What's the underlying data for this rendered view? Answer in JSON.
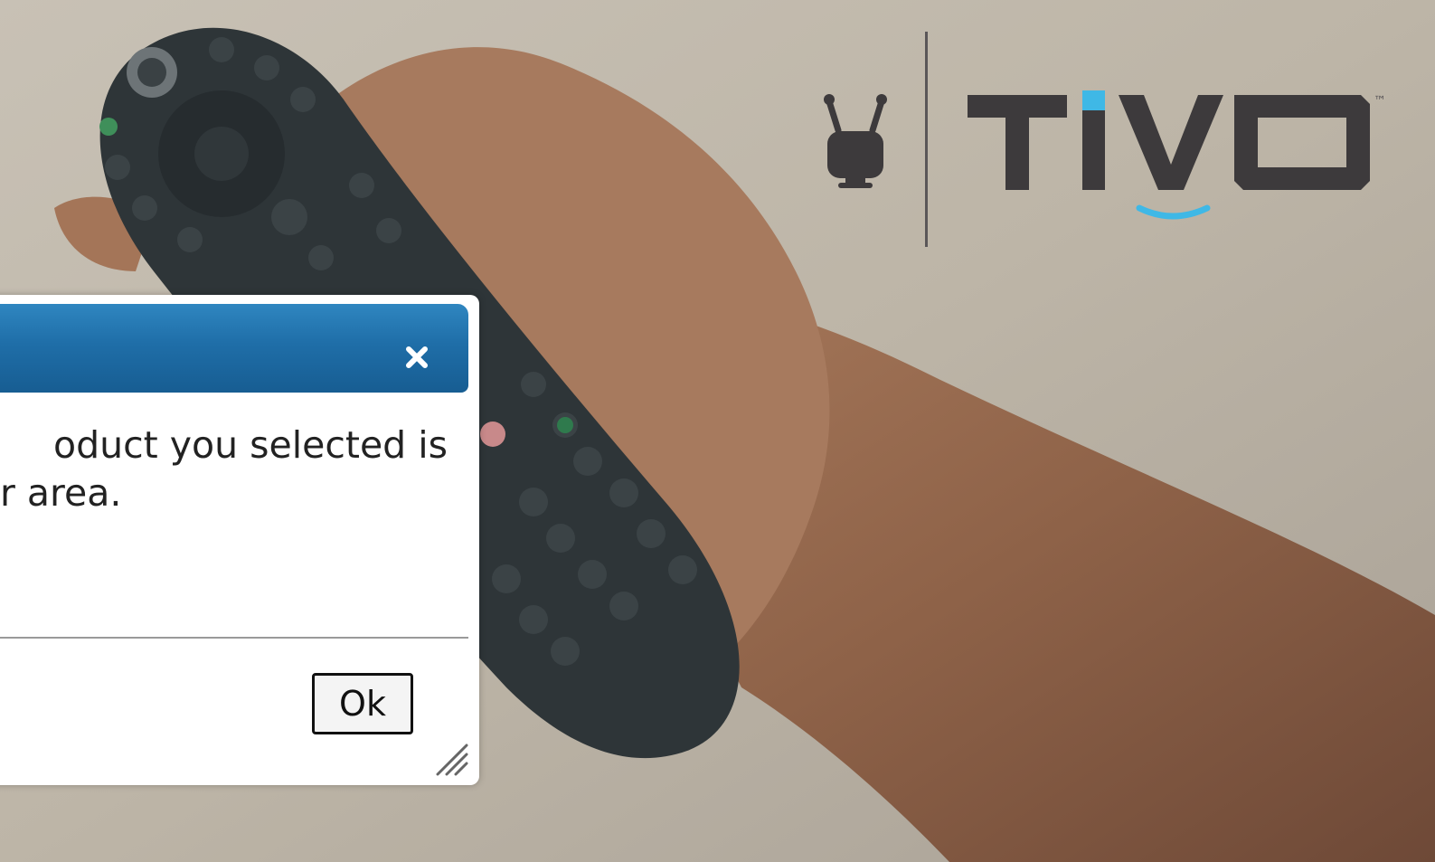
{
  "brand": {
    "name": "TIVO",
    "trademark": "™",
    "accent_color": "#3fb8e6",
    "logo_color": "#3d3a3c"
  },
  "dialog": {
    "titlebar_color": "#1f6ea8",
    "message_lines": [
      "oduct you selected is",
      "r area."
    ],
    "ok_label": "Ok",
    "close_icon": "close-icon"
  }
}
